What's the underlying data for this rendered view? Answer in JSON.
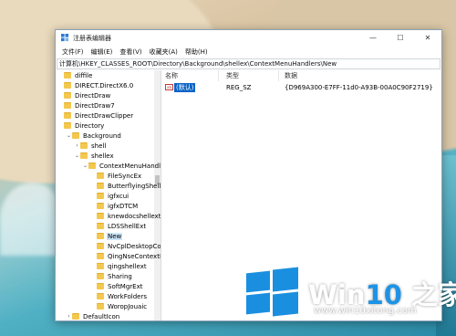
{
  "window": {
    "title": "注册表编辑器",
    "minimize": "—",
    "maximize": "☐",
    "close": "✕"
  },
  "menu": [
    "文件(F)",
    "编辑(E)",
    "查看(V)",
    "收藏夹(A)",
    "帮助(H)"
  ],
  "address": "计算机\\HKEY_CLASSES_ROOT\\Directory\\Background\\shellex\\ContextMenuHandlers\\New",
  "tree": [
    {
      "label": "diffile",
      "indent": 0,
      "arrow": "",
      "selected": false
    },
    {
      "label": "DIRECT.DirectX6.0",
      "indent": 0,
      "arrow": "",
      "selected": false
    },
    {
      "label": "DirectDraw",
      "indent": 0,
      "arrow": "",
      "selected": false
    },
    {
      "label": "DirectDraw7",
      "indent": 0,
      "arrow": "",
      "selected": false
    },
    {
      "label": "DirectDrawClipper",
      "indent": 0,
      "arrow": "",
      "selected": false
    },
    {
      "label": "Directory",
      "indent": 0,
      "arrow": "",
      "selected": false
    },
    {
      "label": "Background",
      "indent": 1,
      "arrow": "⌄",
      "selected": false
    },
    {
      "label": "shell",
      "indent": 2,
      "arrow": "›",
      "selected": false
    },
    {
      "label": "shellex",
      "indent": 2,
      "arrow": "⌄",
      "selected": false
    },
    {
      "label": "ContextMenuHandlers",
      "indent": 3,
      "arrow": "⌄",
      "selected": false
    },
    {
      "label": "FileSyncEx",
      "indent": 4,
      "arrow": "",
      "selected": false
    },
    {
      "label": "ButterflyingShell",
      "indent": 4,
      "arrow": "",
      "selected": false
    },
    {
      "label": "igfxcui",
      "indent": 4,
      "arrow": "",
      "selected": false
    },
    {
      "label": "igfxDTCM",
      "indent": 4,
      "arrow": "",
      "selected": false
    },
    {
      "label": "knewdocshellext",
      "indent": 4,
      "arrow": "",
      "selected": false
    },
    {
      "label": "LDSShellExt",
      "indent": 4,
      "arrow": "",
      "selected": false
    },
    {
      "label": "New",
      "indent": 4,
      "arrow": "",
      "selected": true
    },
    {
      "label": "NvCplDesktopContext",
      "indent": 4,
      "arrow": "",
      "selected": false
    },
    {
      "label": "QingNseContextMenu",
      "indent": 4,
      "arrow": "",
      "selected": false
    },
    {
      "label": "qingshellext",
      "indent": 4,
      "arrow": "",
      "selected": false
    },
    {
      "label": "Sharing",
      "indent": 4,
      "arrow": "",
      "selected": false
    },
    {
      "label": "SoftMgrExt",
      "indent": 4,
      "arrow": "",
      "selected": false
    },
    {
      "label": "WorkFolders",
      "indent": 4,
      "arrow": "",
      "selected": false
    },
    {
      "label": "WoropJouaic",
      "indent": 4,
      "arrow": "",
      "selected": false
    },
    {
      "label": "DefaultIcon",
      "indent": 1,
      "arrow": "›",
      "selected": false
    }
  ],
  "columns": {
    "name": "名称",
    "type": "类型",
    "data": "数据"
  },
  "values": [
    {
      "icon": "ab",
      "name": "(默认)",
      "type": "REG_SZ",
      "data": "{D969A300-E7FF-11d0-A93B-00A0C90F2719}"
    }
  ],
  "watermark": {
    "prefix": "Win",
    "number": "10",
    "suffix": " 之家",
    "url": "www.win10xitong.com"
  },
  "colors": {
    "accent": "#1a8fe0",
    "folder": "#f3c84e",
    "selection": "#0a64c6"
  }
}
